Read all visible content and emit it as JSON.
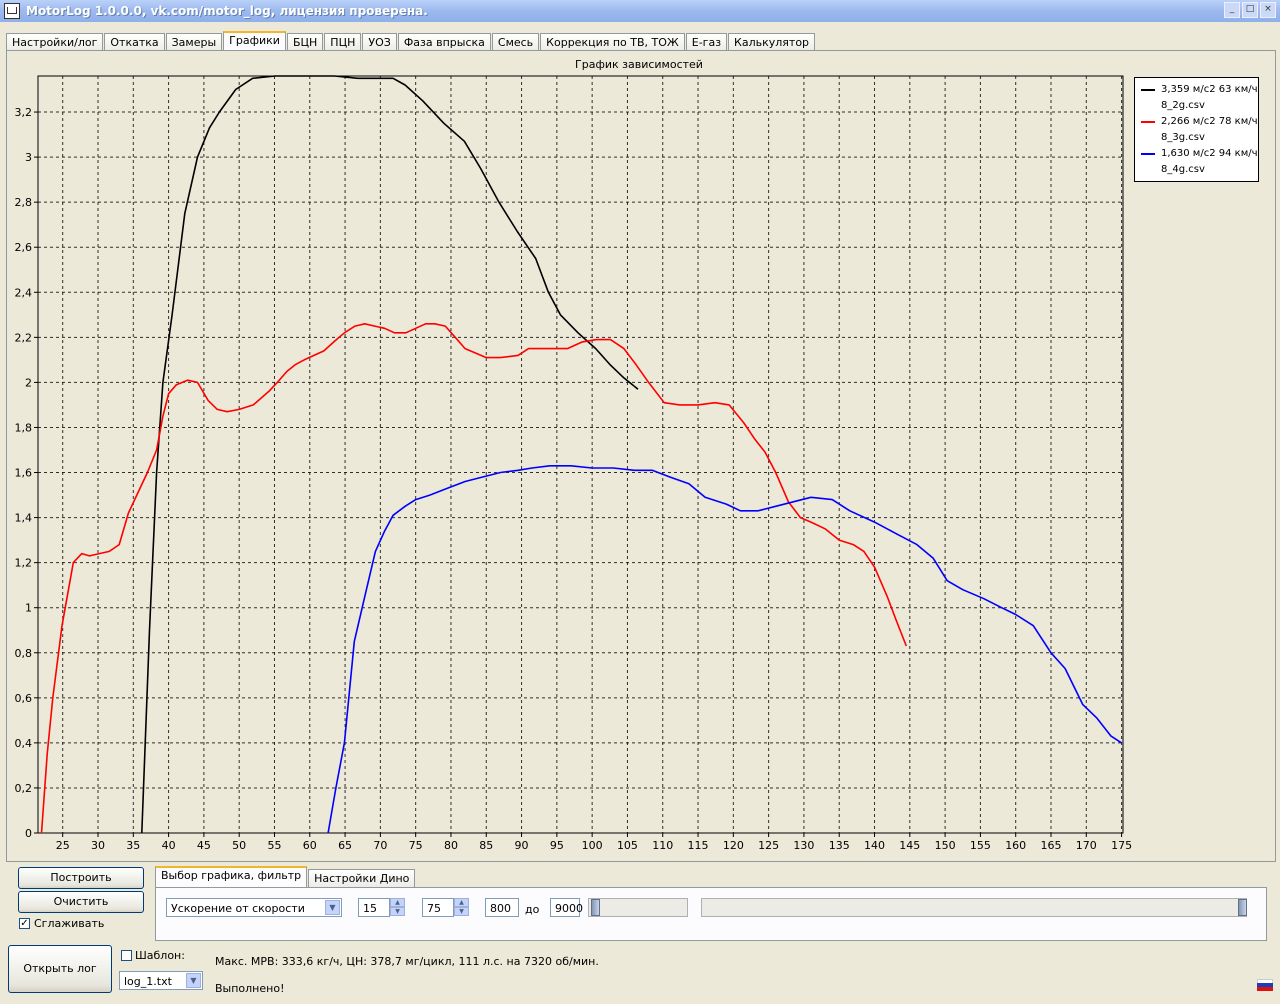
{
  "window": {
    "title": "MotorLog 1.0.0.0, vk.com/motor_log, лицензия проверена."
  },
  "tabs": [
    "Настройки/лог",
    "Откатка",
    "Замеры",
    "Графики",
    "БЦН",
    "ПЦН",
    "УОЗ",
    "Фаза впрыска",
    "Смесь",
    "Коррекция по ТВ, ТОЖ",
    "Е-газ",
    "Калькулятор"
  ],
  "active_tab": "Графики",
  "chart_data": {
    "type": "line",
    "title": "График зависимостей",
    "xlabel": "",
    "ylabel": "",
    "xlim": [
      21.5,
      175.2
    ],
    "ylim": [
      0,
      3.36
    ],
    "grid": true,
    "legend_position": "right",
    "x_ticks": [
      25,
      30,
      35,
      40,
      45,
      50,
      55,
      60,
      65,
      70,
      75,
      80,
      85,
      90,
      95,
      100,
      105,
      110,
      115,
      120,
      125,
      130,
      135,
      140,
      145,
      150,
      155,
      160,
      165,
      170,
      175
    ],
    "y_ticks": [
      0,
      0.2,
      0.4,
      0.6,
      0.8,
      1,
      1.2,
      1.4,
      1.6,
      1.8,
      2,
      2.2,
      2.4,
      2.6,
      2.8,
      3,
      3.2
    ],
    "y_tick_labels": [
      "0",
      "0,2",
      "0,4",
      "0,6",
      "0,8",
      "1",
      "1,2",
      "1,4",
      "1,6",
      "1,8",
      "2",
      "2,2",
      "2,4",
      "2,6",
      "2,8",
      "3",
      "3,2"
    ],
    "series": [
      {
        "name": "3,359 м/с2 63 км/ч\n8_2g.csv",
        "color": "#000000",
        "x": [
          36.2,
          37.3,
          38.3,
          39.2,
          40.5,
          42.3,
          44.1,
          45.8,
          47.2,
          49.5,
          51.9,
          55.1,
          59.3,
          63.5,
          66.8,
          70.3,
          71.8,
          73.5,
          76.0,
          79.0,
          81.9,
          84.2,
          86.8,
          89.4,
          92.0,
          93.8,
          95.5,
          98.0,
          100.5,
          102.5,
          104.5,
          106.5
        ],
        "y": [
          0,
          0.9,
          1.6,
          2.0,
          2.3,
          2.75,
          3.0,
          3.13,
          3.2,
          3.3,
          3.35,
          3.36,
          3.36,
          3.36,
          3.35,
          3.35,
          3.35,
          3.32,
          3.25,
          3.15,
          3.07,
          2.95,
          2.8,
          2.67,
          2.55,
          2.4,
          2.3,
          2.22,
          2.15,
          2.08,
          2.02,
          1.97
        ]
      },
      {
        "name": "2,266 м/с2 78 км/ч\n8_3g.csv",
        "color": "#ff0000",
        "x": [
          22.0,
          22.8,
          23.6,
          24.9,
          26.5,
          27.7,
          28.8,
          30.2,
          31.6,
          33.0,
          34.3,
          35.5,
          37.0,
          38.3,
          39.2,
          40.0,
          41.1,
          42.7,
          44.1,
          45.6,
          46.9,
          48.3,
          50.0,
          52.0,
          54.2,
          55.4,
          56.8,
          58.0,
          59.2,
          60.6,
          62.0,
          63.4,
          64.9,
          66.4,
          67.8,
          69.2,
          70.6,
          72.0,
          73.6,
          75.0,
          76.4,
          77.7,
          79.2,
          80.6,
          82.0,
          83.5,
          85.0,
          87.0,
          89.5,
          91.0,
          92.5,
          94.3,
          96.5,
          98.6,
          100.6,
          102.6,
          104.5,
          106.2,
          108.0,
          110.2,
          112.4,
          115.0,
          117.4,
          119.4,
          121.5,
          123.0,
          124.5,
          126.0,
          127.8,
          129.5,
          131.0,
          133.0,
          135.0,
          137.0,
          138.5,
          140.0,
          141.8,
          143.0,
          144.5
        ],
        "y": [
          0,
          0.35,
          0.6,
          0.92,
          1.2,
          1.24,
          1.23,
          1.24,
          1.25,
          1.28,
          1.42,
          1.5,
          1.6,
          1.7,
          1.85,
          1.95,
          1.99,
          2.01,
          2.0,
          1.92,
          1.88,
          1.87,
          1.88,
          1.9,
          1.96,
          2.0,
          2.05,
          2.08,
          2.1,
          2.12,
          2.14,
          2.18,
          2.22,
          2.25,
          2.26,
          2.25,
          2.24,
          2.22,
          2.22,
          2.24,
          2.26,
          2.26,
          2.25,
          2.2,
          2.15,
          2.13,
          2.11,
          2.11,
          2.12,
          2.15,
          2.15,
          2.15,
          2.15,
          2.18,
          2.19,
          2.19,
          2.15,
          2.08,
          2.0,
          1.91,
          1.9,
          1.9,
          1.91,
          1.9,
          1.82,
          1.75,
          1.69,
          1.6,
          1.47,
          1.4,
          1.38,
          1.35,
          1.3,
          1.28,
          1.25,
          1.18,
          1.05,
          0.95,
          0.83
        ]
      },
      {
        "name": "1,630 м/с2 94 км/ч\n8_4g.csv",
        "color": "#0000ff",
        "x": [
          62.6,
          63.7,
          64.9,
          66.3,
          67.8,
          69.3,
          70.6,
          71.8,
          73.5,
          75.0,
          77.0,
          79.5,
          82.0,
          84.5,
          87.0,
          89.5,
          91.5,
          94.0,
          97.0,
          100.0,
          103.0,
          106.0,
          108.5,
          111.0,
          113.7,
          116.0,
          119.0,
          121.0,
          123.5,
          126.0,
          128.5,
          131.0,
          134.0,
          136.5,
          140.0,
          143.0,
          146.0,
          148.3,
          150.3,
          152.5,
          155.5,
          158.0,
          160.0,
          162.5,
          165.0,
          167.0,
          169.5,
          171.5,
          173.5,
          175.0
        ],
        "y": [
          0,
          0.2,
          0.4,
          0.85,
          1.05,
          1.25,
          1.34,
          1.41,
          1.45,
          1.48,
          1.5,
          1.53,
          1.56,
          1.58,
          1.6,
          1.61,
          1.62,
          1.63,
          1.63,
          1.62,
          1.62,
          1.61,
          1.61,
          1.58,
          1.55,
          1.49,
          1.46,
          1.43,
          1.43,
          1.45,
          1.47,
          1.49,
          1.48,
          1.43,
          1.38,
          1.33,
          1.28,
          1.22,
          1.12,
          1.08,
          1.04,
          1.0,
          0.97,
          0.92,
          0.8,
          0.73,
          0.57,
          0.51,
          0.43,
          0.4
        ]
      }
    ]
  },
  "controls": {
    "build": "Построить",
    "clear": "Очистить",
    "smooth_label": "Сглаживать",
    "tab1": "Выбор графика, фильтр",
    "tab2": "Настройки Дино",
    "graph_type": "Ускорение от скорости",
    "speed_from": "15",
    "speed_to": "75",
    "rpm_from": "800",
    "to_label": "до",
    "rpm_to": "9000",
    "open_log": "Открыть лог",
    "template_label": "Шаблон:",
    "log_file": "log_1.txt",
    "status_line": "Макс. МРВ: 333,6 кг/ч, ЦН: 378,7 мг/цикл, 111 л.с. на 7320 об/мин.",
    "status_done": "Выполнено!"
  },
  "colors": {
    "plot_bg": "#ece9d8",
    "accent": "#f1b62b",
    "title_bar": "#9db8ee"
  }
}
